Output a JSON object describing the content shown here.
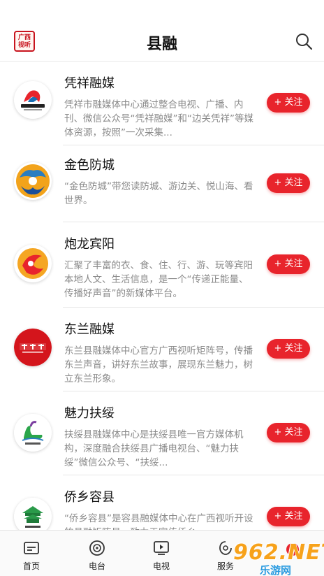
{
  "app": {
    "logo_text": "广西视听",
    "title": "县融"
  },
  "colors": {
    "accent": "#e8242c",
    "text_primary": "#111111",
    "text_secondary": "#8a8a8a"
  },
  "list": [
    {
      "name": "凭祥融媒",
      "desc": "凭祥市融媒体中心通过整合电视、广播、内刊、微信公众号“凭祥融媒”和“边关凭祥”等媒体资源，按照”一次采集...",
      "follow": "+ 关注",
      "avatar_icon": "pingxiang-logo-icon"
    },
    {
      "name": "金色防城",
      "desc": "“金色防城”带您读防城、游边关、悦山海、看世界。",
      "follow": "+ 关注",
      "avatar_icon": "fangcheng-logo-icon"
    },
    {
      "name": "炮龙宾阳",
      "desc": "汇聚了丰富的衣、食、住、行、游、玩等宾阳本地人文、生活信息，是一个“传递正能量、传播好声音”的新媒体平台。",
      "follow": "+ 关注",
      "avatar_icon": "binyang-logo-icon"
    },
    {
      "name": "东兰融媒",
      "desc": "东兰县融媒体中心官方广西视听矩阵号，传播东兰声音，讲好东兰故事，展现东兰魅力，树立东兰形象。",
      "follow": "+ 关注",
      "avatar_icon": "donglan-logo-icon"
    },
    {
      "name": "魅力扶绥",
      "desc": "扶绥县融媒体中心是扶绥县唯一官方媒体机构，深度融合扶绥县广播电视台、“魅力扶绥”微信公众号、“扶绥...",
      "follow": "+ 关注",
      "avatar_icon": "fusui-logo-icon"
    },
    {
      "name": "侨乡容县",
      "desc": "“侨乡容县”是容县融媒体中心在广西视听开设的县融矩阵号，致力于宣传侨乡",
      "follow": "+ 关注",
      "avatar_icon": "rongxian-logo-icon"
    }
  ],
  "tabs": [
    {
      "label": "首页",
      "icon": "home-icon"
    },
    {
      "label": "电台",
      "icon": "radio-icon"
    },
    {
      "label": "电视",
      "icon": "tv-icon"
    },
    {
      "label": "服务",
      "icon": "service-icon"
    }
  ],
  "watermark": {
    "big": "962.NET",
    "small": "乐游网"
  }
}
